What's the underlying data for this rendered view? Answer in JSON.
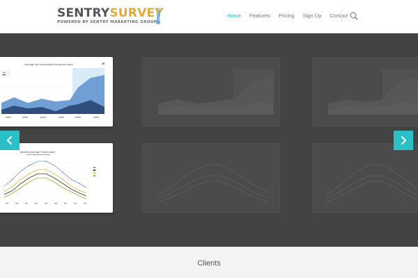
{
  "header": {
    "logo": {
      "part1": "SENTRY",
      "part2": "SURVEY",
      "tagline": "POWERED BY SENTRY MARKETING GROUP"
    },
    "nav": [
      {
        "label": "Home",
        "active": true
      },
      {
        "label": "Features",
        "active": false
      },
      {
        "label": "Pricing",
        "active": false
      },
      {
        "label": "Sign Up",
        "active": false
      },
      {
        "label": "Contact",
        "active": false
      }
    ],
    "search_icon": "search-icon"
  },
  "gallery": {
    "cards": [
      {
        "chart": "area",
        "title": "Average fruit consumption during one week",
        "dimmed": false
      },
      {
        "chart": "area",
        "title": "",
        "dimmed": true
      },
      {
        "chart": "area",
        "title": "",
        "dimmed": true
      },
      {
        "chart": "line",
        "title": "Monthly Average Temperature",
        "dimmed": false
      },
      {
        "chart": "line",
        "title": "",
        "dimmed": true
      },
      {
        "chart": "line",
        "title": "",
        "dimmed": true
      }
    ],
    "prev_icon": "chevron-left-icon",
    "next_icon": "chevron-right-icon"
  },
  "clients": {
    "title": "Clients"
  },
  "colors": {
    "accent": "#2bbfc8",
    "nav_active": "#2bb9c9",
    "logo_gold": "#e0a93a",
    "overlay": "#434343"
  }
}
